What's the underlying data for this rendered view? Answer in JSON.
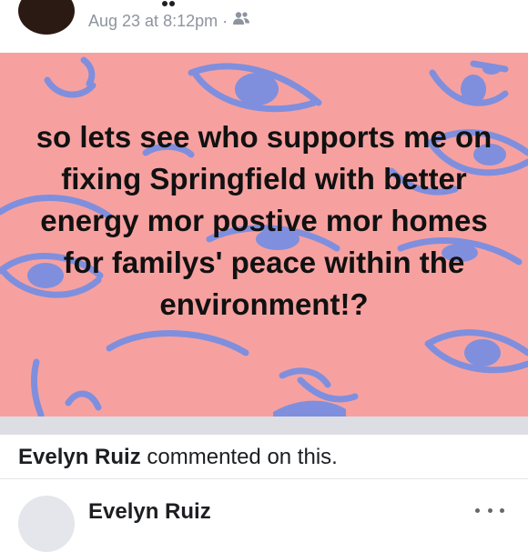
{
  "post": {
    "timestamp": "Aug 23 at 8:12pm",
    "separator": "·",
    "audience_icon": "friends-icon",
    "image_text": "so lets see who supports me on fixing Springfield with better energy mor postive mor homes for familys' peace within the environment!?",
    "background_color": "#f6a1a0",
    "doodle_color": "#7f8fdd"
  },
  "activity": {
    "actor": "Evelyn Ruiz",
    "action": " commented on this."
  },
  "comment": {
    "author": "Evelyn Ruiz",
    "more_icon": "more-options-icon"
  }
}
